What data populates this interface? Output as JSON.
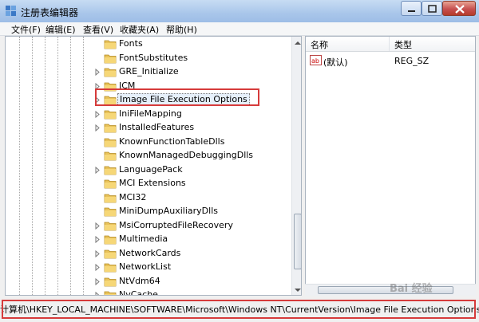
{
  "window": {
    "title": "注册表编辑器",
    "colors": {
      "title_bar": "#a9c6ea",
      "close": "#c75050",
      "highlight": "#d63b3b"
    }
  },
  "menu": [
    {
      "label": "文件(F)"
    },
    {
      "label": "编辑(E)"
    },
    {
      "label": "查看(V)"
    },
    {
      "label": "收藏夹(A)"
    },
    {
      "label": "帮助(H)"
    }
  ],
  "tree": {
    "items": [
      {
        "label": "Fonts",
        "expandable": false
      },
      {
        "label": "FontSubstitutes",
        "expandable": false
      },
      {
        "label": "GRE_Initialize",
        "expandable": true
      },
      {
        "label": "ICM",
        "expandable": true
      },
      {
        "label": "Image File Execution Options",
        "expandable": true,
        "selected": true
      },
      {
        "label": "IniFileMapping",
        "expandable": true
      },
      {
        "label": "InstalledFeatures",
        "expandable": true
      },
      {
        "label": "KnownFunctionTableDlls",
        "expandable": false
      },
      {
        "label": "KnownManagedDebuggingDlls",
        "expandable": false
      },
      {
        "label": "LanguagePack",
        "expandable": true
      },
      {
        "label": "MCI Extensions",
        "expandable": false
      },
      {
        "label": "MCI32",
        "expandable": false
      },
      {
        "label": "MiniDumpAuxiliaryDlls",
        "expandable": false
      },
      {
        "label": "MsiCorruptedFileRecovery",
        "expandable": true
      },
      {
        "label": "Multimedia",
        "expandable": true
      },
      {
        "label": "NetworkCards",
        "expandable": true
      },
      {
        "label": "NetworkList",
        "expandable": true
      },
      {
        "label": "NtVdm64",
        "expandable": true
      },
      {
        "label": "NvCache",
        "expandable": true
      }
    ]
  },
  "list": {
    "columns": {
      "name": "名称",
      "type": "类型"
    },
    "rows": [
      {
        "name": "(默认)",
        "type": "REG_SZ",
        "icon": "string-value-icon"
      }
    ]
  },
  "status": {
    "path": "计算机\\HKEY_LOCAL_MACHINE\\SOFTWARE\\Microsoft\\Windows NT\\CurrentVersion\\Image File Execution Options"
  },
  "watermark": "Bai 经验"
}
